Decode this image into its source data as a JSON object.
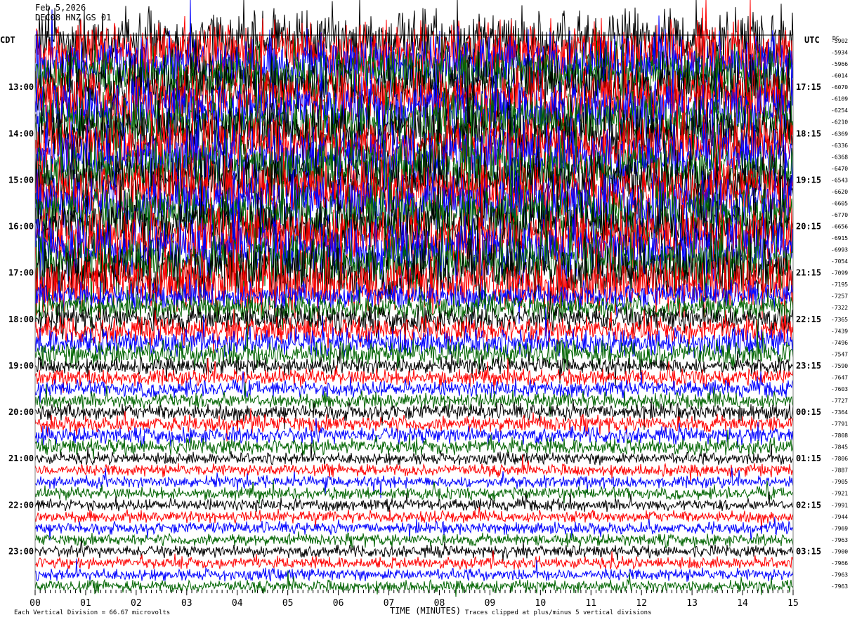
{
  "header": {
    "date": "Feb 5,2026",
    "station": "DEC08 HNZ GS 01"
  },
  "chart_data": {
    "type": "line",
    "title": "Feb 5,2026 DEC08 HNZ GS 01",
    "xlabel": "TIME (MINUTES)",
    "xlim": [
      0,
      15
    ],
    "x_ticks": [
      "00",
      "01",
      "02",
      "03",
      "04",
      "05",
      "06",
      "07",
      "08",
      "09",
      "10",
      "11",
      "12",
      "13",
      "14",
      "15"
    ],
    "left_timezone": "CDT",
    "right_timezone": "UTC",
    "dc_header": "DC",
    "left_labels": [
      "13:00",
      "14:00",
      "15:00",
      "16:00",
      "17:00",
      "18:00",
      "19:00",
      "20:00",
      "21:00",
      "22:00",
      "23:00"
    ],
    "right_labels": [
      "17:15",
      "18:15",
      "19:15",
      "20:15",
      "21:15",
      "22:15",
      "23:15",
      "00:15",
      "01:15",
      "02:15",
      "03:15"
    ],
    "dc_offsets": [
      "-5902",
      "-5934",
      "-5966",
      "-6014",
      "-6070",
      "-6109",
      "-6254",
      "-6210",
      "-6369",
      "-6336",
      "-6368",
      "-6470",
      "-6543",
      "-6620",
      "-6605",
      "-6770",
      "-6656",
      "-6915",
      "-6993",
      "-7054",
      "-7099",
      "-7195",
      "-7257",
      "-7322",
      "-7365",
      "-7439",
      "-7496",
      "-7547",
      "-7590",
      "-7647",
      "-7603",
      "-7727",
      "-7364",
      "-7791",
      "-7808",
      "-7845",
      "-7806",
      "-7887",
      "-7905",
      "-7921",
      "-7991",
      "-7944",
      "-7969",
      "-7963",
      "-7900",
      "-7966",
      "-7963",
      "-7963"
    ],
    "trace_colors": [
      "#000000",
      "#ff0000",
      "#0000ff",
      "#006400"
    ],
    "scale_note": "Each Vertical Division =   66.67 microvolts",
    "clip_note": "Traces clipped at plus/minus 5 vertical divisions"
  }
}
